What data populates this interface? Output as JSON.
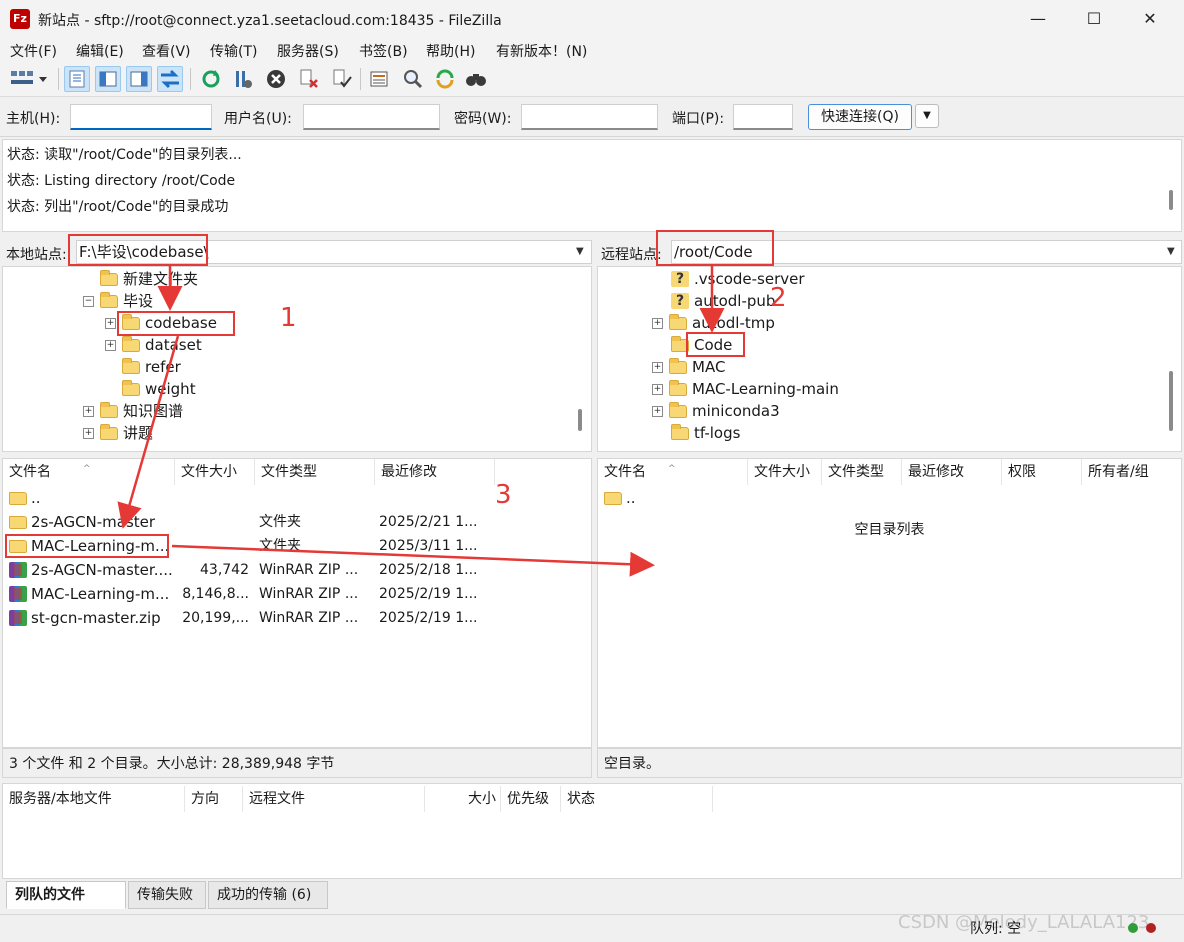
{
  "window": {
    "title": "新站点 - sftp://root@connect.yza1.seetacloud.com:18435 - FileZilla",
    "app_icon_text": "Fz",
    "minimize": "—",
    "maximize": "☐",
    "close": "✕"
  },
  "menu": [
    {
      "label": "文件(F)"
    },
    {
      "label": "编辑(E)"
    },
    {
      "label": "查看(V)"
    },
    {
      "label": "传输(T)"
    },
    {
      "label": "服务器(S)"
    },
    {
      "label": "书签(B)"
    },
    {
      "label": "帮助(H)"
    },
    {
      "label": "有新版本！(N)"
    }
  ],
  "quickconnect": {
    "host_label": "主机(H):",
    "user_label": "用户名(U):",
    "pass_label": "密码(W):",
    "port_label": "端口(P):",
    "host_value": "",
    "user_value": "",
    "pass_value": "",
    "port_value": "",
    "connect_label": "快速连接(Q)",
    "dropdown_glyph": "▼"
  },
  "log": [
    {
      "text": "状态:  读取\"/root/Code\"的目录列表..."
    },
    {
      "text": "状态:  Listing directory /root/Code"
    },
    {
      "text": "状态:  列出\"/root/Code\"的目录成功"
    }
  ],
  "local": {
    "site_label": "本地站点:",
    "path": "F:\\毕设\\codebase\\",
    "tree": [
      {
        "label": "新建文件夹",
        "expander": ""
      },
      {
        "label": "毕设",
        "expander": "−"
      },
      {
        "label": "codebase",
        "expander": "+"
      },
      {
        "label": "dataset",
        "expander": "+"
      },
      {
        "label": "refer",
        "expander": ""
      },
      {
        "label": "weight",
        "expander": ""
      },
      {
        "label": "知识图谱",
        "expander": "+"
      },
      {
        "label": "讲题",
        "expander": "+"
      }
    ],
    "columns": [
      "文件名",
      "文件大小",
      "文件类型",
      "最近修改"
    ],
    "files": [
      {
        "name": "..",
        "size": "",
        "type": "",
        "modified": "",
        "icon": "folder"
      },
      {
        "name": "2s-AGCN-master",
        "size": "",
        "type": "文件夹",
        "modified": "2025/2/21 1...",
        "icon": "folder"
      },
      {
        "name": "MAC-Learning-m...",
        "size": "",
        "type": "文件夹",
        "modified": "2025/3/11 1...",
        "icon": "folder"
      },
      {
        "name": "2s-AGCN-master....",
        "size": "43,742",
        "type": "WinRAR ZIP ...",
        "modified": "2025/2/18 1...",
        "icon": "zip"
      },
      {
        "name": "MAC-Learning-m...",
        "size": "8,146,8...",
        "type": "WinRAR ZIP ...",
        "modified": "2025/2/19 1...",
        "icon": "zip"
      },
      {
        "name": "st-gcn-master.zip",
        "size": "20,199,...",
        "type": "WinRAR ZIP ...",
        "modified": "2025/2/19 1...",
        "icon": "zip"
      }
    ],
    "status": "3 个文件 和 2 个目录。大小总计: 28,389,948 字节"
  },
  "remote": {
    "site_label": "远程站点:",
    "path": "/root/Code",
    "tree": [
      {
        "label": ".vscode-server",
        "expander": "",
        "icon": "question"
      },
      {
        "label": "autodl-pub",
        "expander": "",
        "icon": "question"
      },
      {
        "label": "autodl-tmp",
        "expander": "+",
        "icon": "folder"
      },
      {
        "label": "Code",
        "expander": "",
        "icon": "folder"
      },
      {
        "label": "MAC",
        "expander": "+",
        "icon": "folder"
      },
      {
        "label": "MAC-Learning-main",
        "expander": "+",
        "icon": "folder"
      },
      {
        "label": "miniconda3",
        "expander": "+",
        "icon": "folder"
      },
      {
        "label": "tf-logs",
        "expander": "",
        "icon": "folder"
      }
    ],
    "columns": [
      "文件名",
      "文件大小",
      "文件类型",
      "最近修改",
      "权限",
      "所有者/组"
    ],
    "files": [
      {
        "name": "..",
        "icon": "folder"
      }
    ],
    "empty_text": "空目录列表",
    "status": "空目录。"
  },
  "queue": {
    "columns": [
      "服务器/本地文件",
      "方向",
      "远程文件",
      "大小",
      "优先级",
      "状态"
    ],
    "tabs": [
      {
        "label": "列队的文件"
      },
      {
        "label": "传输失败"
      },
      {
        "label": "成功的传输 (6)"
      }
    ],
    "status": "队列: 空"
  },
  "watermark": "CSDN @Melody_LALALA123",
  "annotations": {
    "one": "1",
    "two": "2",
    "three": "3"
  },
  "toolbar_icons": [
    "site-manager-icon",
    "toggle-log-icon",
    "toggle-local-tree-icon",
    "toggle-remote-tree-icon",
    "toggle-queue-icon",
    "refresh-icon",
    "process-queue-icon",
    "cancel-icon",
    "disconnect-icon",
    "reconnect-icon",
    "filter-icon",
    "compare-icon",
    "sync-browse-icon",
    "search-icon"
  ],
  "colors": {
    "annotation_red": "#e53935",
    "accent_blue": "#0067c0",
    "folder_yellow": "#f8d775"
  }
}
